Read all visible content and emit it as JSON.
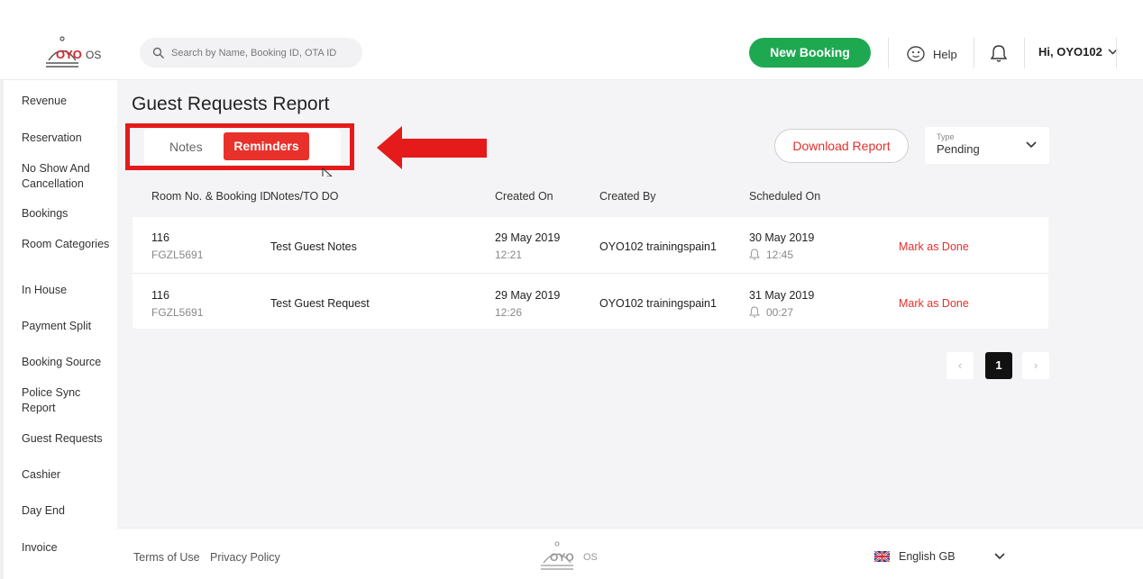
{
  "header": {
    "logo_text": "OYO",
    "logo_suffix": "OS",
    "search_placeholder": "Search by Name, Booking ID, OTA ID",
    "new_booking_label": "New Booking",
    "help_label": "Help",
    "user_label": "Hi, OYO102",
    "accent_green": "#1ea951"
  },
  "sidebar": {
    "items": [
      {
        "label": "Revenue"
      },
      {
        "label": "Reservation"
      },
      {
        "label": "No Show And Cancellation"
      },
      {
        "label": "Bookings"
      },
      {
        "label": "Room Categories"
      },
      {
        "label": "In House"
      },
      {
        "label": "Payment Split"
      },
      {
        "label": "Booking Source"
      },
      {
        "label": "Police Sync Report"
      },
      {
        "label": "Guest Requests"
      },
      {
        "label": "Cashier"
      },
      {
        "label": "Day End"
      },
      {
        "label": "Invoice"
      }
    ]
  },
  "main": {
    "title": "Guest Requests Report",
    "tabs": [
      {
        "label": "Notes",
        "active": false
      },
      {
        "label": "Reminders",
        "active": true
      }
    ],
    "download_label": "Download Report",
    "type_filter": {
      "label": "Type",
      "value": "Pending"
    },
    "accent_red": "#e3302b",
    "table": {
      "headers": [
        "Room No. & Booking ID",
        "Notes/TO DO",
        "Created On",
        "Created By",
        "Scheduled On"
      ],
      "rows": [
        {
          "room": "116",
          "booking_id": "FGZL5691",
          "note": "Test Guest Notes",
          "created_date": "29 May 2019",
          "created_time": "12:21",
          "created_by": "OYO102 trainingspain1",
          "scheduled_date": "30 May 2019",
          "scheduled_time": "12:45",
          "action": "Mark as Done"
        },
        {
          "room": "116",
          "booking_id": "FGZL5691",
          "note": "Test Guest Request",
          "created_date": "29 May 2019",
          "created_time": "12:26",
          "created_by": "OYO102 trainingspain1",
          "scheduled_date": "31 May 2019",
          "scheduled_time": "00:27",
          "action": "Mark as Done"
        }
      ]
    },
    "pagination": {
      "prev": "‹",
      "current": "1",
      "next": "›"
    }
  },
  "footer": {
    "terms_label": "Terms of Use",
    "privacy_label": "Privacy Policy",
    "logo_text": "OYO",
    "logo_suffix": "OS",
    "language": "English GB"
  },
  "icons": {
    "search": "search-icon",
    "help": "help-face-icon",
    "bell": "bell-icon",
    "chevron": "chevron-down-icon",
    "arrow": "red-arrow-annotation",
    "flag": "uk-flag-icon"
  }
}
